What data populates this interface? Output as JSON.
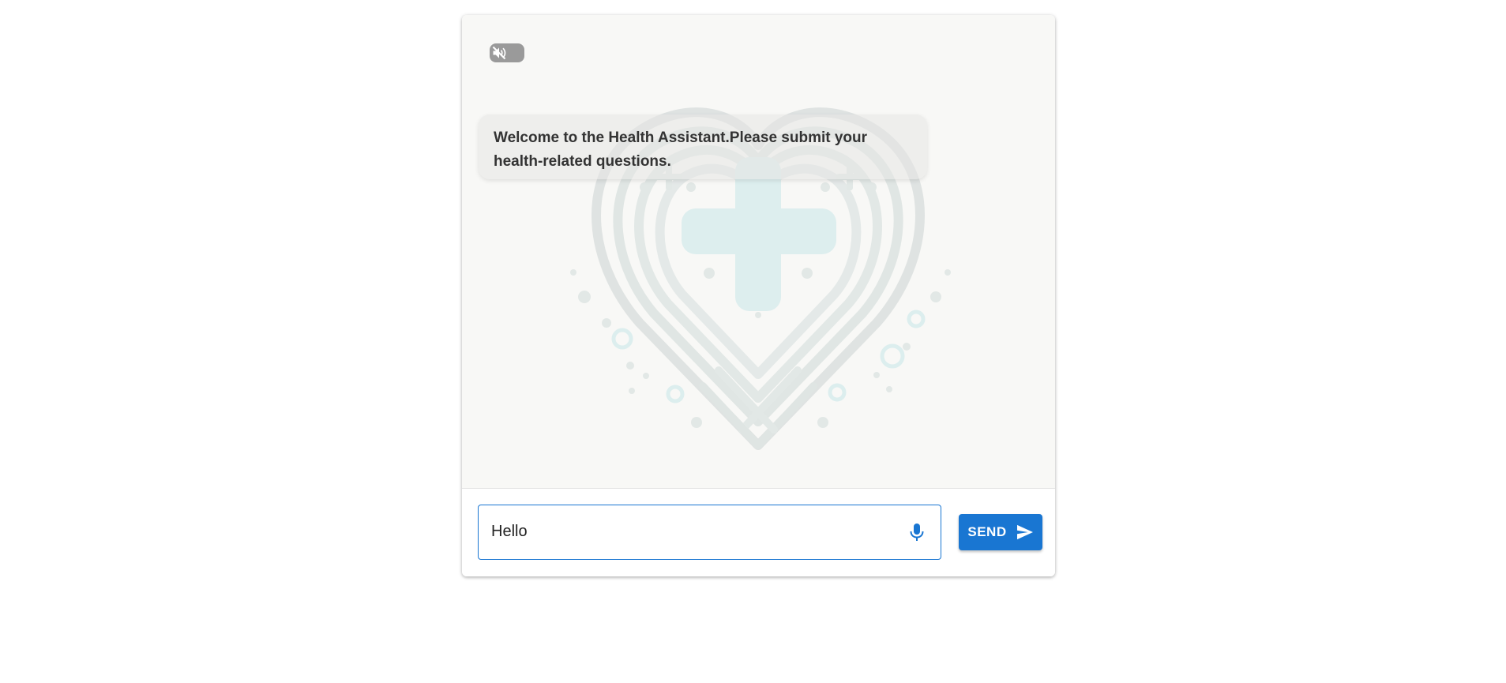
{
  "chat": {
    "welcome_message": "Welcome to the Health Assistant.Please submit your health-related questions."
  },
  "composer": {
    "input_value": "Hello",
    "placeholder": "",
    "send_label": "SEND"
  },
  "icons": {
    "toggle": "volume-off-icon",
    "mic": "microphone-icon",
    "send": "send-icon",
    "background": "heart-medical-cross-logo"
  },
  "colors": {
    "accent": "#1976d2",
    "toggle": "#9a9a9a",
    "bubble_text": "#333333",
    "chat_background": "#f8f8f6"
  }
}
